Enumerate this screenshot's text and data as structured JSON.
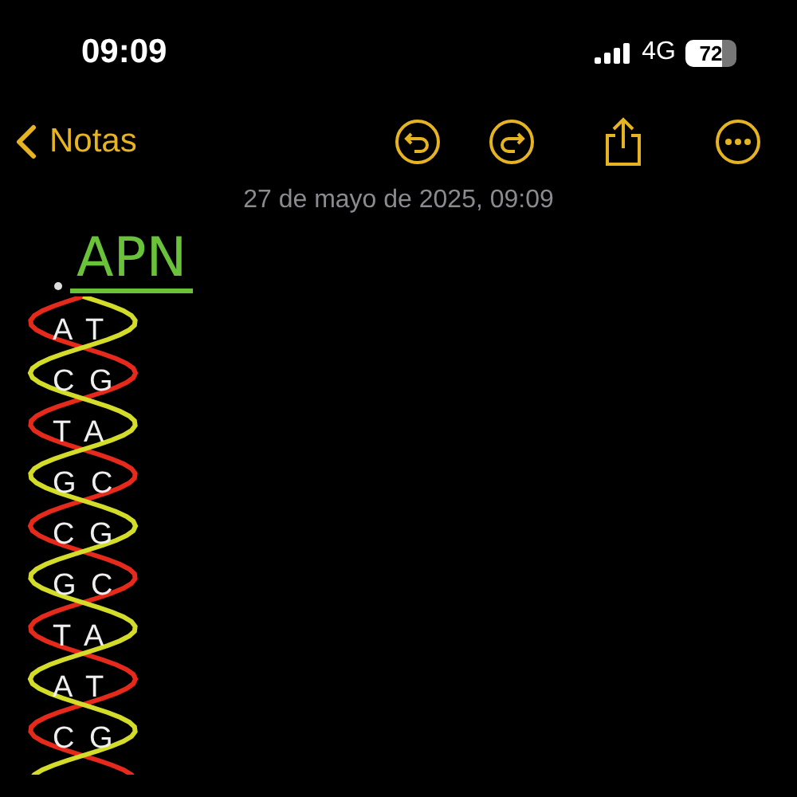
{
  "status_bar": {
    "time": "09:09",
    "network": "4G",
    "battery": "72"
  },
  "toolbar": {
    "back_label": "Notas"
  },
  "note": {
    "date": "27 de mayo de 2025, 09:09",
    "title": "APN",
    "pairs": [
      "A T",
      "C G",
      "T A",
      "G C",
      "C G",
      "G C",
      "T A",
      "A T",
      "C G"
    ]
  }
}
